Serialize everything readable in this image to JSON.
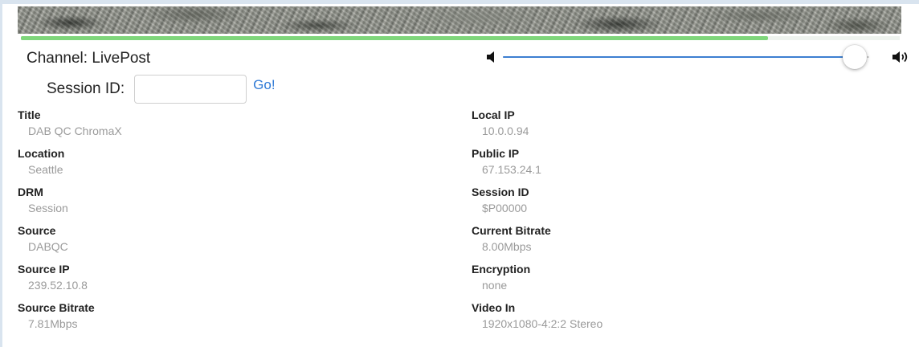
{
  "player": {
    "progress_fraction": 0.85,
    "volume_fraction": 0.96
  },
  "channel": {
    "label": "Channel: LivePost"
  },
  "session": {
    "label": "Session ID:",
    "input_value": "",
    "input_placeholder": "",
    "go_label": "Go!"
  },
  "icons": {
    "volume_low": "speaker-low-icon",
    "volume_high": "speaker-high-icon"
  },
  "colors": {
    "progress": "#7fd67b",
    "slider": "#3d7fd1",
    "link": "#2f7ad6"
  },
  "info_left": [
    {
      "label": "Title",
      "value": "DAB QC ChromaX"
    },
    {
      "label": "Location",
      "value": "Seattle"
    },
    {
      "label": "DRM",
      "value": "Session"
    },
    {
      "label": "Source",
      "value": "DABQC"
    },
    {
      "label": "Source IP",
      "value": "239.52.10.8"
    },
    {
      "label": "Source Bitrate",
      "value": "7.81Mbps"
    }
  ],
  "info_right": [
    {
      "label": "Local IP",
      "value": "10.0.0.94"
    },
    {
      "label": "Public IP",
      "value": "67.153.24.1"
    },
    {
      "label": "Session ID",
      "value": "$P00000"
    },
    {
      "label": "Current Bitrate",
      "value": "8.00Mbps"
    },
    {
      "label": "Encryption",
      "value": "none"
    },
    {
      "label": "Video In",
      "value": "1920x1080-4:2:2 Stereo"
    }
  ]
}
